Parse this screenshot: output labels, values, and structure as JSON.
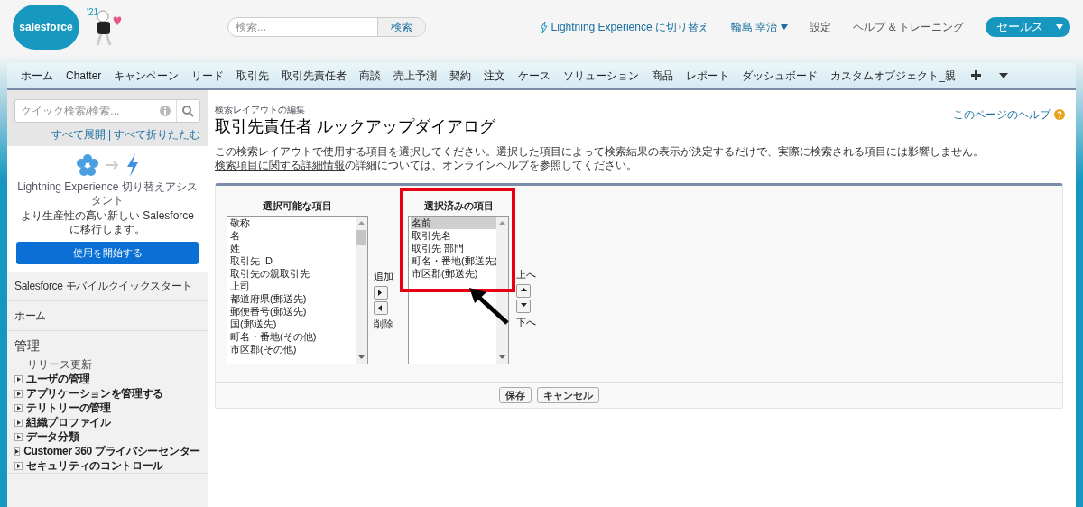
{
  "header": {
    "logo": "salesforce",
    "badge": "'21",
    "search": {
      "placeholder": "検索...",
      "button": "検索"
    },
    "links": [
      {
        "kind": "lightning",
        "label": "Lightning Experience に切り替え"
      },
      {
        "kind": "user",
        "label": "輪島 幸治"
      },
      {
        "kind": "plain",
        "label": "設定"
      },
      {
        "kind": "plain",
        "label": "ヘルプ & トレーニング"
      }
    ],
    "app_menu": "セールス"
  },
  "tabs": [
    {
      "label": "ホーム",
      "selected": false
    },
    {
      "label": "Chatter",
      "selected": false
    },
    {
      "label": "キャンペーン",
      "selected": false
    },
    {
      "label": "リード",
      "selected": false
    },
    {
      "label": "取引先",
      "selected": false
    },
    {
      "label": "取引先責任者",
      "selected": false
    },
    {
      "label": "商談",
      "selected": false
    },
    {
      "label": "売上予測",
      "selected": false
    },
    {
      "label": "契約",
      "selected": false
    },
    {
      "label": "注文",
      "selected": false
    },
    {
      "label": "ケース",
      "selected": false
    },
    {
      "label": "ソリューション",
      "selected": false
    },
    {
      "label": "商品",
      "selected": false
    },
    {
      "label": "レポート",
      "selected": false
    },
    {
      "label": "ダッシュボード",
      "selected": false
    },
    {
      "label": "カスタムオブジェクト_親",
      "selected": false
    }
  ],
  "sidebar": {
    "search": {
      "placeholder": "クイック検索/検索..."
    },
    "expand_all": "すべて展開",
    "separator": "|",
    "collapse_all": "すべて折りたたむ",
    "promo": {
      "title": "Lightning Experience 切り替えアシスタント",
      "text": "より生産性の高い新しい Salesforce に移行します。",
      "button": "使用を開始する"
    },
    "sections": [
      {
        "label": "Salesforce モバイルクイックスタート"
      },
      {
        "label": "ホーム"
      },
      {
        "label": "管理",
        "items": [
          {
            "kind": "leaf",
            "label": "リリース更新"
          },
          {
            "kind": "group",
            "label": "ユーザの管理",
            "expanded": false
          },
          {
            "kind": "group",
            "label": "アプリケーションを管理する",
            "expanded": false
          },
          {
            "kind": "group",
            "label": "テリトリーの管理",
            "expanded": false
          },
          {
            "kind": "group",
            "label": "組織プロファイル",
            "expanded": false
          },
          {
            "kind": "group",
            "label": "データ分類",
            "expanded": false
          },
          {
            "kind": "group",
            "label": "Customer 360 プライバシーセンター",
            "expanded": false
          },
          {
            "kind": "group",
            "label": "セキュリティのコントロール",
            "expanded": false
          }
        ]
      }
    ]
  },
  "page": {
    "breadcrumb": "検索レイアウトの編集",
    "title": "取引先責任者 ルックアップダイアログ",
    "help": "このページのヘルプ",
    "description": {
      "before": "この検索レイアウトで使用する項目を選択してください。選択した項目によって検索結果の表示が決定するだけで、実際に検索される項目には影響しません。",
      "link": "検索項目に関する詳細情報",
      "after": "の詳細については、オンラインヘルプを参照してください。"
    },
    "available": {
      "heading": "選択可能な項目",
      "items": [
        {
          "label": "敬称",
          "selected": false
        },
        {
          "label": "名",
          "selected": false
        },
        {
          "label": "姓",
          "selected": false
        },
        {
          "label": "取引先 ID",
          "selected": false
        },
        {
          "label": "取引先の親取引先",
          "selected": false
        },
        {
          "label": "上司",
          "selected": false
        },
        {
          "label": "都道府県(郵送先)",
          "selected": false
        },
        {
          "label": "郵便番号(郵送先)",
          "selected": false
        },
        {
          "label": "国(郵送先)",
          "selected": false
        },
        {
          "label": "町名・番地(その他)",
          "selected": false
        },
        {
          "label": "市区郡(その他)",
          "selected": false
        }
      ]
    },
    "add": "追加",
    "remove": "削除",
    "chosen": {
      "heading": "選択済みの項目",
      "items": [
        {
          "label": "名前",
          "selected": true
        },
        {
          "label": "取引先名",
          "selected": false
        },
        {
          "label": "取引先 部門",
          "selected": false
        },
        {
          "label": "町名・番地(郵送先)",
          "selected": false
        },
        {
          "label": "市区郡(郵送先)",
          "selected": false
        }
      ]
    },
    "up": "上へ",
    "down": "下へ",
    "buttons": [
      "保存",
      "キャンセル"
    ]
  }
}
